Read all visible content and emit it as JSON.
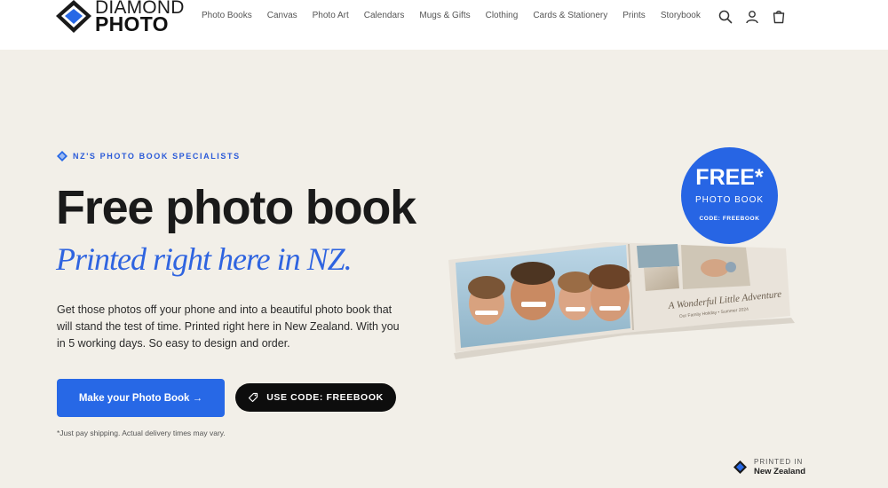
{
  "brand": {
    "line1": "DIAMOND",
    "line2": "PHOTO",
    "accent": "#2768e6"
  },
  "nav": {
    "items": [
      "Photo Books",
      "Canvas",
      "Photo Art",
      "Calendars",
      "Mugs & Gifts",
      "Clothing",
      "Cards & Stationery",
      "Prints",
      "Storybook"
    ],
    "icons": [
      "search-icon",
      "account-icon",
      "cart-icon"
    ]
  },
  "hero": {
    "eyebrow": "NZ'S PHOTO BOOK SPECIALISTS",
    "title": "Free photo book",
    "subtitle": "Printed right here in NZ.",
    "description": "Get those photos off your phone and into a beautiful photo book that will stand the test of time. Printed right here in New Zealand. With you in 5 working days. So easy to design and order.",
    "cta_label": "Make your Photo Book →",
    "code_label": "USE CODE: FREEBOOK",
    "note": "*Just pay shipping. Actual delivery times may vary."
  },
  "badge": {
    "headline": "FREE*",
    "sub": "PHOTO BOOK",
    "code": "CODE: FREEBOOK"
  },
  "book": {
    "caption_title": "A Wonderful Little Adventure",
    "caption_sub": "Our Family Holiday • Summer 2024"
  },
  "printed": {
    "line1": "PRINTED IN",
    "line2": "New Zealand"
  }
}
